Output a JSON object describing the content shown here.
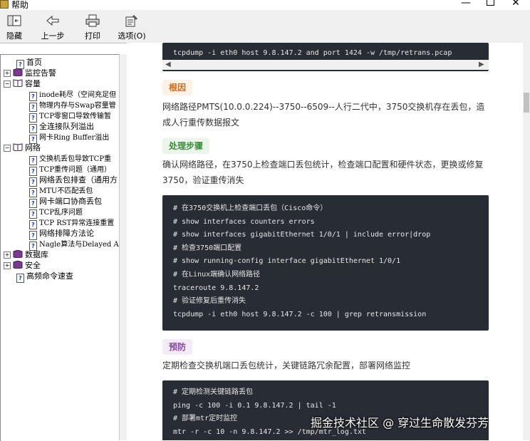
{
  "window": {
    "title": "帮助",
    "min": "—",
    "close": "✕"
  },
  "toolbar": {
    "hide": "隐藏",
    "back": "上一步",
    "print": "打印",
    "options": "选项(O)"
  },
  "tree": {
    "items": [
      "首页",
      "监控告警",
      "容量",
      "inode耗尽（空间充足但",
      "物理内存与Swap容量管",
      "TCP零窗口导致传输暂",
      "全连接队列溢出",
      "网卡Ring Buffer溢出",
      "网络",
      "交换机丢包导致TCP重",
      "TCP重传问题（通用）",
      "网络丢包排查（通用方",
      "MTU不匹配丢包",
      "网卡端口协商丢包",
      "TCP乱序问题",
      "TCP RST异常连接重置",
      "网络排障方法论",
      "Nagle算法与Delayed A",
      "数据库",
      "安全",
      "高频命令速查"
    ]
  },
  "content": {
    "code_top": "tcpdump -i eth0 host 9.8.147.2 and port 1424 -w /tmp/retrans.pcap",
    "tag_cause": "根因",
    "cause_text": "网络路径PMTS(10.0.0.224)--3750--6509--人行二代中，3750交换机存在丢包，造成人行重传数据报文",
    "tag_steps": "处理步骤",
    "steps_text": "确认网络路径，在3750上检查端口丢包统计，检查端口配置和硬件状态，更换或修复3750，验证重传消失",
    "code_steps": [
      "# 在3750交换机上检查端口丢包（Cisco命令）",
      "# show interfaces counters errors",
      "# show interfaces gigabitEthernet 1/0/1 | include error|drop",
      "# 检查3750端口配置",
      "# show running-config interface gigabitEthernet 1/0/1",
      "# 在Linux端确认网络路径",
      "traceroute 9.8.147.2",
      "# 验证修复后重传消失",
      "tcpdump -i eth0 host 9.8.147.2 -c 100 | grep retransmission"
    ],
    "tag_prevent": "预防",
    "prevent_text": "定期检查交换机端口丢包统计，关键链路冗余配置，部署网络监控",
    "code_prevent": [
      "# 定期检测关键链路丢包",
      "ping -c 100 -i 0.1 9.8.147.2 | tail -1",
      "# 部署mtr定时监控",
      "mtr -r -c 10 -n 9.8.147.2 >> /tmp/mtr_log.txt"
    ]
  },
  "watermark": "掘金技术社区 @ 穿过生命散发芬芳"
}
